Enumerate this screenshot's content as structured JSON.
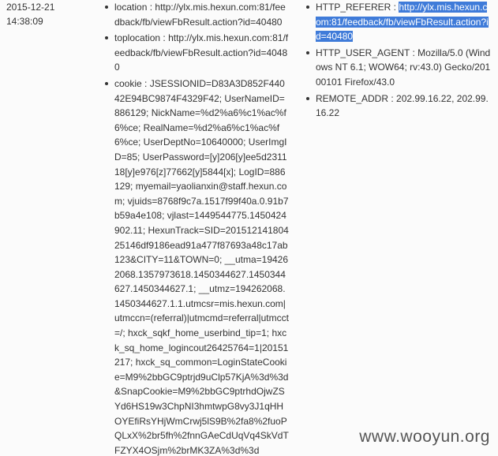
{
  "date": "2015-12-21",
  "time": "14:38:09",
  "middle_list": [
    {
      "key": "location",
      "value": "http://ylx.mis.hexun.com:81/feedback/fb/viewFbResult.action?id=40480"
    },
    {
      "key": "toplocation",
      "value": "http://ylx.mis.hexun.com:81/feedback/fb/viewFbResult.action?id=40480"
    },
    {
      "key": "cookie",
      "value": "JSESSIONID=D83A3D852F44042E94BC9874F4329F42; UserNameID=886129; NickName=%d2%a6%c1%ac%f6%ce; RealName=%d2%a6%c1%ac%f6%ce; UserDeptNo=10640000; UserImgID=85; UserPassword=[y]206[y]ee5d231118[y]e976[z]77662[y]5844[x]; LogID=886129; myemail=yaolianxin@staff.hexun.com; vjuids=8768f9c7a.1517f99f40a.0.91b7b59a4e108; vjlast=1449544775.1450424902.11; HexunTrack=SID=20151214180425146df9186ead91a477f87693a48c17ab123&CITY=11&TOWN=0; __utma=194262068.1357973618.1450344627.1450344627.1450344627.1; __utmz=194262068.1450344627.1.1.utmcsr=mis.hexun.com|utmccn=(referral)|utmcmd=referral|utmcct=/; hxck_sqkf_home_userbind_tip=1; hxck_sq_home_logincout26425764=1|20151217; hxck_sq_common=LoginStateCookie=M9%2bbGC9ptrjd9uClp57KjA%3d%3d&SnapCookie=M9%2bbGC9ptrhdOjwZSYd6HS19w3ChpNI3hmtwpG8vy3J1qHHOYEfiRsYHjWmCrwj5lS9B%2fa8%2fuoPQLxX%2br5fh%2fnnGAeCdUqVq4SkVdTFZYX4OSjm%2brMK3ZA%3d%3d"
    }
  ],
  "right_list": [
    {
      "key": "HTTP_REFERER",
      "value": "http://ylx.mis.hexun.com:81/feedback/fb/viewFbResult.action?id=40480"
    },
    {
      "key": "HTTP_USER_AGENT",
      "value": "Mozilla/5.0 (Windows NT 6.1; WOW64; rv:43.0) Gecko/20100101 Firefox/43.0"
    },
    {
      "key": "REMOTE_ADDR",
      "value": "202.99.16.22, 202.99.16.22"
    }
  ],
  "watermark": "www.wooyun.org",
  "separator": " : ",
  "colors": {
    "text": "#333333",
    "selection": "#3f7bd9",
    "background": "#fbfbfb"
  }
}
